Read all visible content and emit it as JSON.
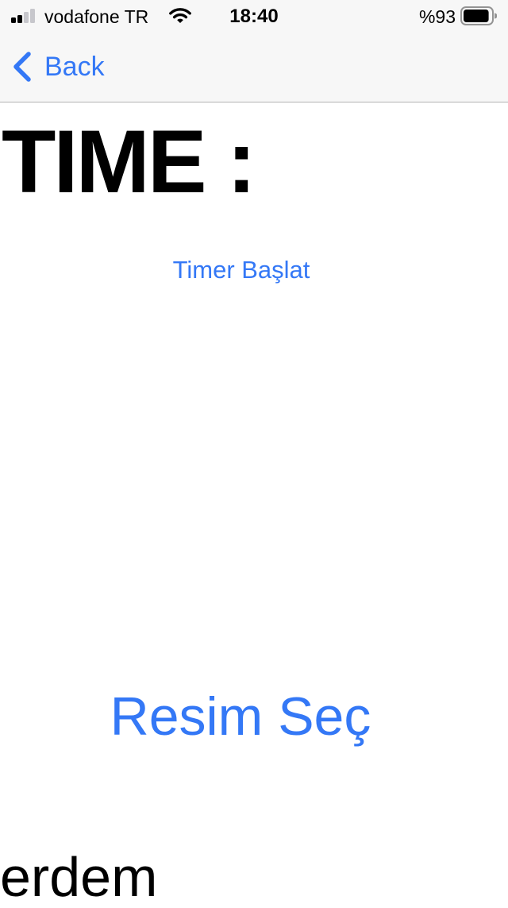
{
  "status_bar": {
    "carrier": "vodafone TR",
    "time": "18:40",
    "battery_percent_text": "%93",
    "battery_level": 0.93,
    "signal_bars_active": 2,
    "signal_bars_total": 4,
    "icons": [
      "signal-icon",
      "wifi-icon",
      "battery-icon"
    ]
  },
  "nav": {
    "back_label": "Back",
    "back_icon": "chevron-left-icon"
  },
  "content": {
    "time_label": "TIME :",
    "timer_button": "Timer Başlat",
    "pick_image_button": "Resim Seç",
    "name_label": "erdem"
  },
  "colors": {
    "accent": "#3478f6",
    "text": "#000000",
    "bar_background": "#f7f7f7",
    "separator": "#b2b2b2",
    "inactive_signal": "#c7c7cc"
  }
}
